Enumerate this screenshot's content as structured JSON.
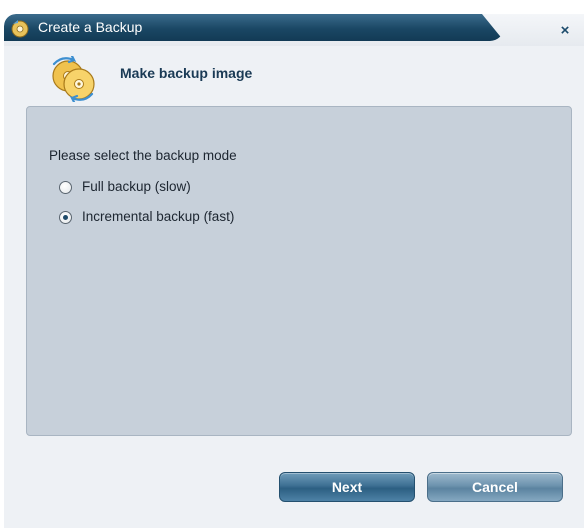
{
  "window": {
    "title": "Create a Backup",
    "close_glyph": "×",
    "icons": {
      "title": "backup-disc-icon",
      "header": "backup-discs-icon",
      "close": "close-icon"
    }
  },
  "header": {
    "title": "Make backup image"
  },
  "mode": {
    "prompt": "Please select the backup mode",
    "options": [
      {
        "label": "Full backup (slow)",
        "selected": false
      },
      {
        "label": "Incremental backup (fast)",
        "selected": true
      }
    ]
  },
  "buttons": {
    "next": "Next",
    "cancel": "Cancel"
  },
  "colors": {
    "titlebar": "#1a4764",
    "panel": "#c7d0da",
    "window_bg": "#eef1f5",
    "button": "#3e7093"
  }
}
